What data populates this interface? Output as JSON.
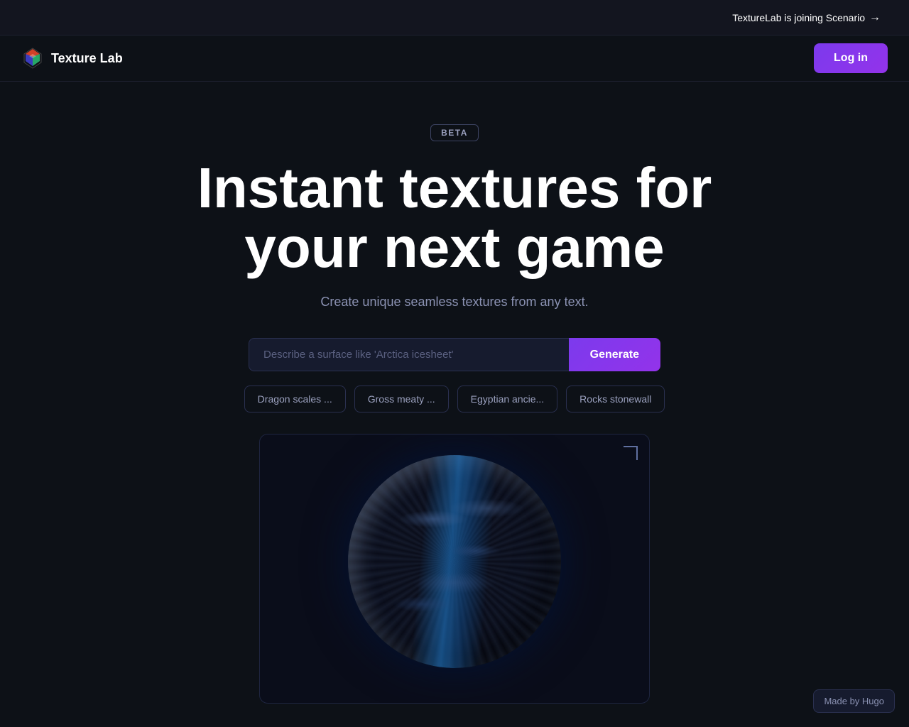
{
  "announcement": {
    "text": "TextureLab is joining Scenario",
    "arrow": "→"
  },
  "navbar": {
    "logo_text": "Texture Lab",
    "login_label": "Log in"
  },
  "hero": {
    "beta_label": "BETA",
    "title_line1": "Instant textures for",
    "title_line2": "your next game",
    "subtitle": "Create unique seamless textures from any text."
  },
  "search": {
    "placeholder": "Describe a surface like 'Arctica icesheet'",
    "generate_label": "Generate"
  },
  "chips": [
    {
      "label": "Dragon scales ..."
    },
    {
      "label": "Gross meaty ..."
    },
    {
      "label": "Egyptian ancie..."
    },
    {
      "label": "Rocks stonewall"
    }
  ],
  "footer": {
    "made_by": "Made by Hugo"
  }
}
